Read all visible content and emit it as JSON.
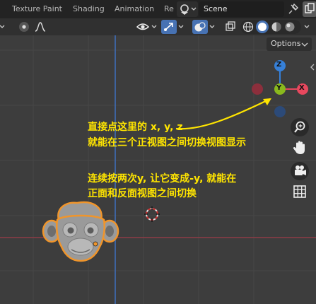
{
  "workspace_tabs": [
    {
      "label": "Texture Paint"
    },
    {
      "label": "Shading"
    },
    {
      "label": "Animation"
    },
    {
      "label": "Re"
    }
  ],
  "scene": {
    "name": "Scene"
  },
  "viewport": {
    "options_label": "Options",
    "gizmo": {
      "z_label": "Z",
      "y_label": "Y",
      "x_label": "X"
    },
    "annotations": {
      "line1": "直接点这里的 x, y, z",
      "line2": "就能在三个正视图之间切换视图显示",
      "line3": "连续按两次y, 让它变成-y, 就能在",
      "line4": "正面和反面视图之间切换"
    }
  },
  "colors": {
    "annotation": "#ffe500",
    "axis_x": "#e8485e",
    "axis_y": "#8ab91d",
    "axis_z": "#3680d8",
    "selection_outline": "#f0952b"
  }
}
